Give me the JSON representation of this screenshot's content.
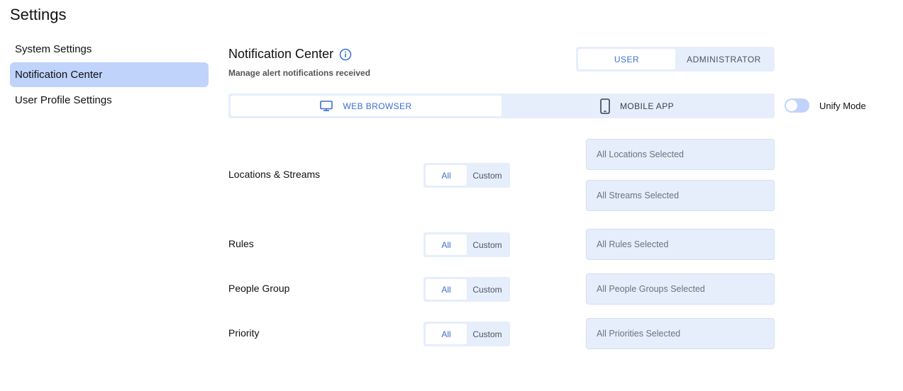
{
  "page": {
    "title": "Settings"
  },
  "sidebar": {
    "items": [
      {
        "label": "System Settings",
        "active": false
      },
      {
        "label": "Notification Center",
        "active": true
      },
      {
        "label": "User Profile Settings",
        "active": false
      }
    ]
  },
  "section": {
    "title": "Notification Center",
    "subtitle": "Manage alert notifications received",
    "info_icon": "info-icon"
  },
  "role_toggle": {
    "options": [
      "USER",
      "ADMINISTRATOR"
    ],
    "selected": "USER"
  },
  "platform_toggle": {
    "options": [
      {
        "label": "WEB BROWSER",
        "icon": "monitor-icon"
      },
      {
        "label": "MOBILE APP",
        "icon": "mobile-phone-icon"
      }
    ],
    "selected": "WEB BROWSER"
  },
  "unify_mode": {
    "label": "Unify Mode",
    "enabled": false
  },
  "filters": {
    "all_label": "All",
    "custom_label": "Custom",
    "rows": [
      {
        "label": "Locations & Streams",
        "mode": "All",
        "selectors": [
          "All Locations Selected",
          "All Streams Selected"
        ]
      },
      {
        "label": "Rules",
        "mode": "All",
        "selectors": [
          "All Rules Selected"
        ]
      },
      {
        "label": "People Group",
        "mode": "All",
        "selectors": [
          "All People Groups Selected"
        ]
      },
      {
        "label": "Priority",
        "mode": "All",
        "selectors": [
          "All Priorities Selected"
        ]
      }
    ]
  },
  "colors": {
    "accent": "#3b6fd1",
    "active_nav": "#bfd3fb",
    "control_bg": "#e6eefb"
  }
}
